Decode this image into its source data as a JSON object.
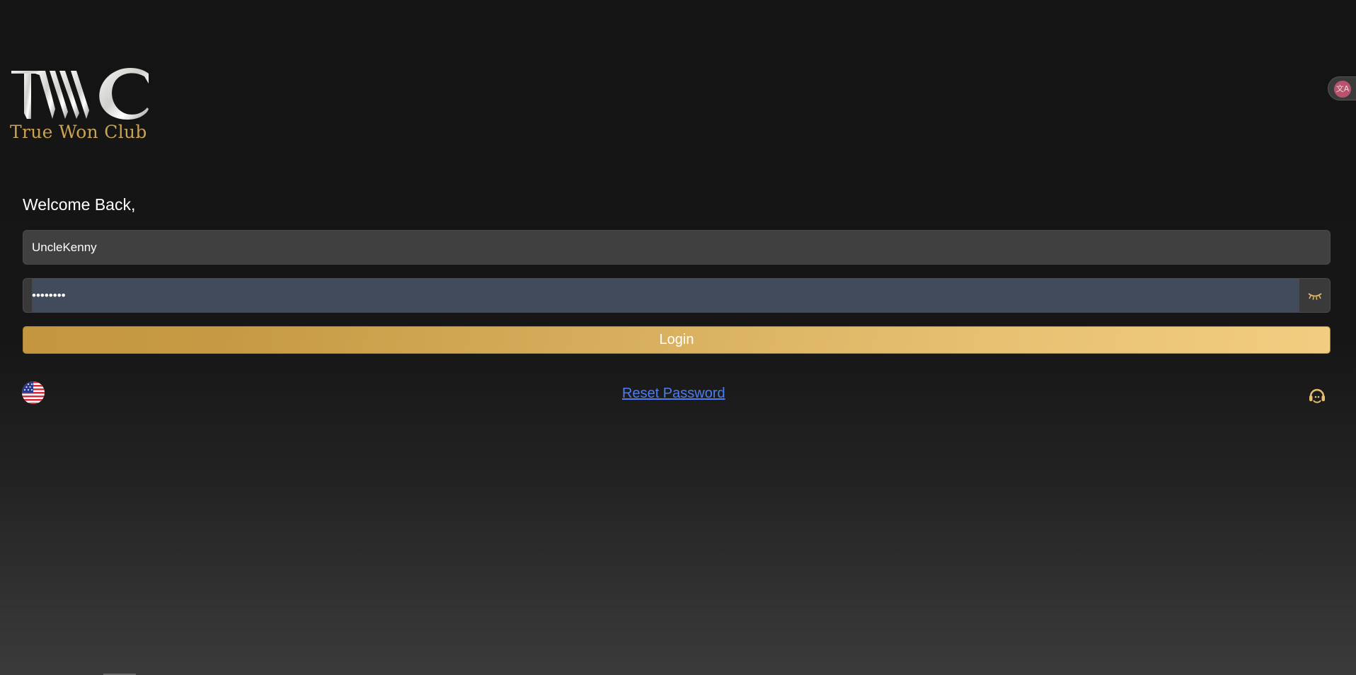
{
  "logo": {
    "mark_text": "TWC",
    "brand_name": "True Won Club"
  },
  "translate": {
    "icon": "translate-icon",
    "glyph": "文A"
  },
  "login_form": {
    "welcome_text": "Welcome Back,",
    "username_value": "UncleKenny",
    "password_value": "••••••••",
    "show_password_icon": "eye-closed-icon",
    "login_label": "Login"
  },
  "footer": {
    "language_icon": "us-flag-icon",
    "reset_password_label": "Reset Password",
    "support_icon": "headset-support-icon"
  },
  "colors": {
    "accent_gold": "#c9a354",
    "link_blue": "#4c7df4",
    "background": "#141414"
  }
}
